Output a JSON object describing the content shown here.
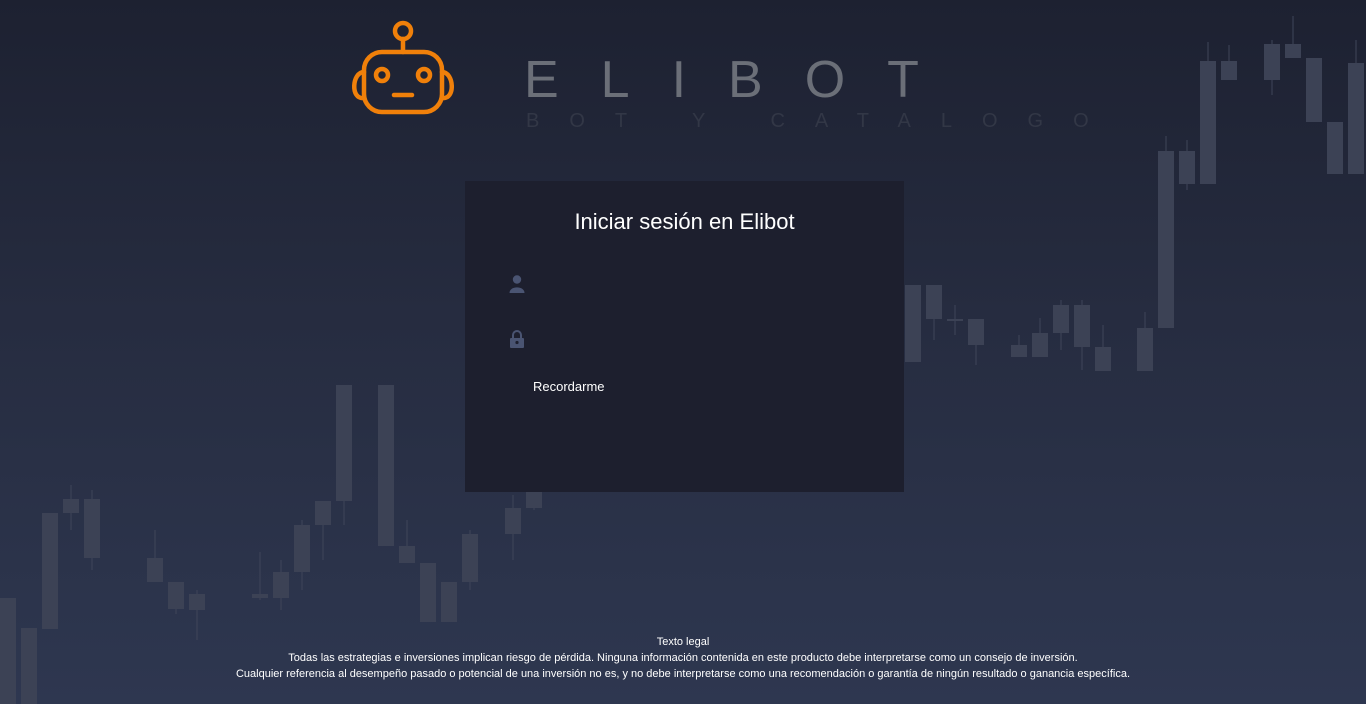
{
  "brand": {
    "name": "ELIBOT",
    "tagline": "BOT Y CATALOGO",
    "logo_icon": "robot-icon",
    "accent_color": "#f0800a"
  },
  "login": {
    "title": "Iniciar sesión en Elibot",
    "username_icon": "user-icon",
    "password_icon": "lock-icon",
    "username_placeholder": "",
    "password_placeholder": "",
    "remember_label": "Recordarme"
  },
  "legal": {
    "heading": "Texto legal",
    "line1": "Todas las estrategias e inversiones implican riesgo de pérdida. Ninguna información contenida en este producto debe interpretarse como un consejo de inversión.",
    "line2": "Cualquier referencia al desempeño pasado o potencial de una inversión no es, y no debe interpretarse como una recomendación o garantía de ningún resultado o ganancia específica."
  }
}
